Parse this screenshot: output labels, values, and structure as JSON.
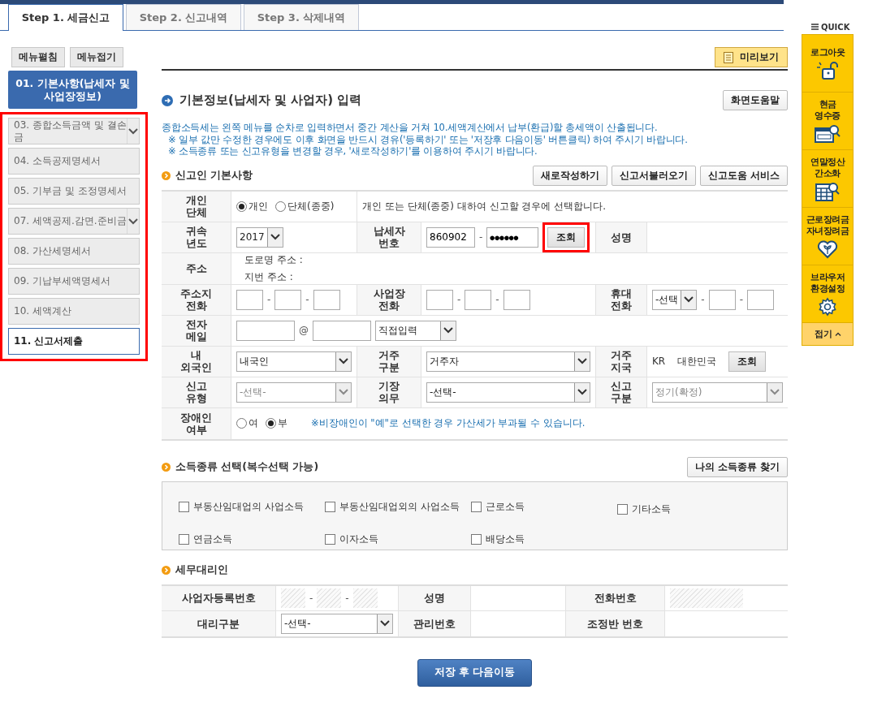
{
  "tabs": [
    {
      "label": "Step 1. 세금신고",
      "selected": true
    },
    {
      "label": "Step 2. 신고내역",
      "selected": false
    },
    {
      "label": "Step 3. 삭제내역",
      "selected": false
    }
  ],
  "sidebar": {
    "buttons": [
      "메뉴펼침",
      "메뉴접기"
    ],
    "current": {
      "label": "01. 기본사항(납세자 및 사업장정보)"
    },
    "group": {
      "highlighted": true,
      "items": [
        {
          "label": "03. 종합소득금액 및 결손금",
          "kind": "dropdown",
          "outlined": false
        },
        {
          "label": "04. 소득공제명세서",
          "kind": "plain",
          "outlined": false
        },
        {
          "label": "05. 기부금 및 조정명세서",
          "kind": "plain",
          "outlined": false
        },
        {
          "label": "07. 세액공제.감면.준비금",
          "kind": "dropdown",
          "outlined": false
        },
        {
          "label": "08. 가산세명세서",
          "kind": "plain",
          "outlined": false
        },
        {
          "label": "09. 기납부세액명세서",
          "kind": "plain",
          "outlined": false
        },
        {
          "label": "10. 세액계산",
          "kind": "plain",
          "outlined": false
        },
        {
          "label": "11. 신고서제출",
          "kind": "plain",
          "outlined": true
        }
      ]
    }
  },
  "preview_button": "미리보기",
  "title": "기본정보(납세자 및 사업자) 입력",
  "help_button": "화면도움말",
  "notices": [
    "종합소득세는 왼쪽 메뉴를 순차로 입력하면서 중간 계산을 거쳐 10.세액계산에서 납부(환급)할 총세액이 산출됩니다.",
    "※ 일부 값만 수정한 경우에도 이후 화면을 반드시 경유('등록하기' 또는 '저장후 다음이동' 버튼클릭) 하여 주시기 바랍니다.",
    "※ 소득종류 또는 신고유형을 변경할 경우, '새로작성하기'를 이용하여 주시기 바랍니다."
  ],
  "filer": {
    "title": "신고인 기본사항",
    "buttons": [
      "새로작성하기",
      "신고서불러오기",
      "신고도움 서비스"
    ],
    "rows": [
      {
        "cells": [
          {
            "kind": "label",
            "label": "개인\n단체"
          },
          {
            "kind": "field",
            "items": [
              {
                "kind": "radio",
                "label": "개인",
                "selected": true
              },
              {
                "kind": "radio",
                "label": "단체(종중)",
                "selected": false
              }
            ]
          },
          {
            "kind": "field",
            "items": [
              {
                "kind": "text",
                "text": "개인 또는 단체(종중) 대하여 신고할 경우에 선택합니다."
              }
            ]
          }
        ]
      },
      {
        "cells": [
          {
            "kind": "label",
            "label": "귀속\n년도"
          },
          {
            "kind": "field",
            "items": [
              {
                "kind": "small-select",
                "value": "2017",
                "disabled": false
              }
            ]
          },
          {
            "kind": "label",
            "label": "납세자\n번호"
          },
          {
            "kind": "field",
            "items": [
              {
                "kind": "id-input",
                "value": "860902"
              },
              {
                "kind": "sep",
                "text": "-"
              },
              {
                "kind": "masked-input",
                "value": "●●●●●●"
              },
              {
                "kind": "button",
                "label": "조회",
                "highlighted": true
              }
            ]
          },
          {
            "kind": "label",
            "label": "성명"
          },
          {
            "kind": "field"
          }
        ]
      },
      {
        "cells": [
          {
            "kind": "label",
            "label": "주소"
          },
          {
            "kind": "field",
            "items": [
              {
                "kind": "lines",
                "lines": [
                  "도로명 주소 :",
                  "지번 주소 :"
                ]
              }
            ]
          }
        ]
      },
      {
        "cells": [
          {
            "kind": "label",
            "label": "주소지\n전화"
          },
          {
            "kind": "field",
            "items": [
              {
                "kind": "short-input",
                "value": ""
              },
              {
                "kind": "sep",
                "text": "-"
              },
              {
                "kind": "short-input",
                "value": ""
              },
              {
                "kind": "sep",
                "text": "-"
              },
              {
                "kind": "short-input",
                "value": ""
              }
            ]
          },
          {
            "kind": "label",
            "label": "사업장\n전화"
          },
          {
            "kind": "field",
            "items": [
              {
                "kind": "short-input",
                "value": ""
              },
              {
                "kind": "sep",
                "text": "-"
              },
              {
                "kind": "short-input",
                "value": ""
              },
              {
                "kind": "sep",
                "text": "-"
              },
              {
                "kind": "short-input",
                "value": ""
              }
            ]
          },
          {
            "kind": "label",
            "label": "휴대\n전화"
          },
          {
            "kind": "field",
            "items": [
              {
                "kind": "small-select",
                "value": "-선택",
                "disabled": false
              },
              {
                "kind": "sep",
                "text": "-"
              },
              {
                "kind": "short-input",
                "value": ""
              },
              {
                "kind": "sep",
                "text": "-"
              },
              {
                "kind": "short-input",
                "value": ""
              }
            ]
          }
        ]
      },
      {
        "cells": [
          {
            "kind": "label",
            "label": "전자\n메일"
          },
          {
            "kind": "field",
            "items": [
              {
                "kind": "input",
                "value": ""
              },
              {
                "kind": "sep",
                "text": "@"
              },
              {
                "kind": "input",
                "value": ""
              },
              {
                "kind": "wide-select",
                "value": "직접입력",
                "disabled": false
              }
            ]
          }
        ]
      },
      {
        "cells": [
          {
            "kind": "label",
            "label": "내\n외국인"
          },
          {
            "kind": "field",
            "items": [
              {
                "kind": "select",
                "value": "내국인",
                "disabled": false
              }
            ]
          },
          {
            "kind": "label",
            "label": "거주\n구분"
          },
          {
            "kind": "field",
            "items": [
              {
                "kind": "select",
                "value": "거주자",
                "disabled": false
              }
            ]
          },
          {
            "kind": "label",
            "label": "거주\n지국"
          },
          {
            "kind": "field",
            "items": [
              {
                "kind": "text",
                "text": "KR"
              },
              {
                "kind": "text",
                "text": "대한민국"
              },
              {
                "kind": "button",
                "label": "조회"
              }
            ]
          }
        ]
      },
      {
        "cells": [
          {
            "kind": "label",
            "label": "신고\n유형"
          },
          {
            "kind": "field",
            "items": [
              {
                "kind": "select",
                "value": "-선택-",
                "disabled": true
              }
            ]
          },
          {
            "kind": "label",
            "label": "기장\n의무"
          },
          {
            "kind": "field",
            "items": [
              {
                "kind": "select",
                "value": "-선택-",
                "disabled": false
              }
            ]
          },
          {
            "kind": "label",
            "label": "신고\n구분"
          },
          {
            "kind": "field",
            "items": [
              {
                "kind": "select",
                "value": "정기(확정)",
                "disabled": true
              }
            ]
          }
        ]
      },
      {
        "cells": [
          {
            "kind": "label",
            "label": "장애인\n여부"
          },
          {
            "kind": "field",
            "items": [
              {
                "kind": "radio",
                "label": "여",
                "selected": false
              },
              {
                "kind": "radio",
                "label": "부",
                "selected": true
              },
              {
                "kind": "note",
                "text": "※비장애인이 \"예\"로 선택한 경우 가산세가 부과될 수 있습니다."
              }
            ]
          }
        ]
      }
    ]
  },
  "income": {
    "title": "소득종류 선택(복수선택 가능)",
    "button": "나의 소득종류 찾기",
    "options": [
      {
        "label": "부동산임대업의 사업소득",
        "checked": false
      },
      {
        "label": "부동산임대업외의 사업소득",
        "checked": false
      },
      {
        "label": "근로소득",
        "checked": false
      },
      {
        "label": "기타소득",
        "checked": false
      },
      {
        "label": "연금소득",
        "checked": false
      },
      {
        "label": "이자소득",
        "checked": false
      },
      {
        "label": "배당소득",
        "checked": false
      }
    ]
  },
  "agent": {
    "title": "세무대리인",
    "rows": [
      {
        "cells": [
          {
            "kind": "label",
            "label": "사업자등록번호"
          },
          {
            "kind": "field",
            "items": [
              {
                "kind": "hatched"
              },
              {
                "kind": "sep",
                "text": "-"
              },
              {
                "kind": "hatched"
              },
              {
                "kind": "sep",
                "text": "-"
              },
              {
                "kind": "hatched"
              }
            ]
          },
          {
            "kind": "label",
            "label": "성명"
          },
          {
            "kind": "field"
          },
          {
            "kind": "label",
            "label": "전화번호"
          },
          {
            "kind": "field",
            "items": [
              {
                "kind": "wide-hatched"
              }
            ]
          }
        ]
      },
      {
        "cells": [
          {
            "kind": "label",
            "label": "대리구분"
          },
          {
            "kind": "field",
            "items": [
              {
                "kind": "select",
                "value": "-선택-",
                "disabled": false
              }
            ]
          },
          {
            "kind": "label",
            "label": "관리번호"
          },
          {
            "kind": "field"
          },
          {
            "kind": "label",
            "label": "조정반 번호"
          },
          {
            "kind": "field"
          }
        ]
      }
    ]
  },
  "save_button": "저장 후 다음이동",
  "quick": {
    "title": "QUICK",
    "items": [
      {
        "label": "로그아웃",
        "kind": "lock"
      },
      {
        "label": "현금\n영수증",
        "kind": "receipt"
      },
      {
        "label": "연말정산\n간소화",
        "kind": "sheet"
      },
      {
        "label": "근로장려금\n자녀장려금",
        "kind": "heart"
      },
      {
        "label": "브라우저\n환경설정",
        "kind": "gear"
      }
    ],
    "collapse": "접기"
  }
}
